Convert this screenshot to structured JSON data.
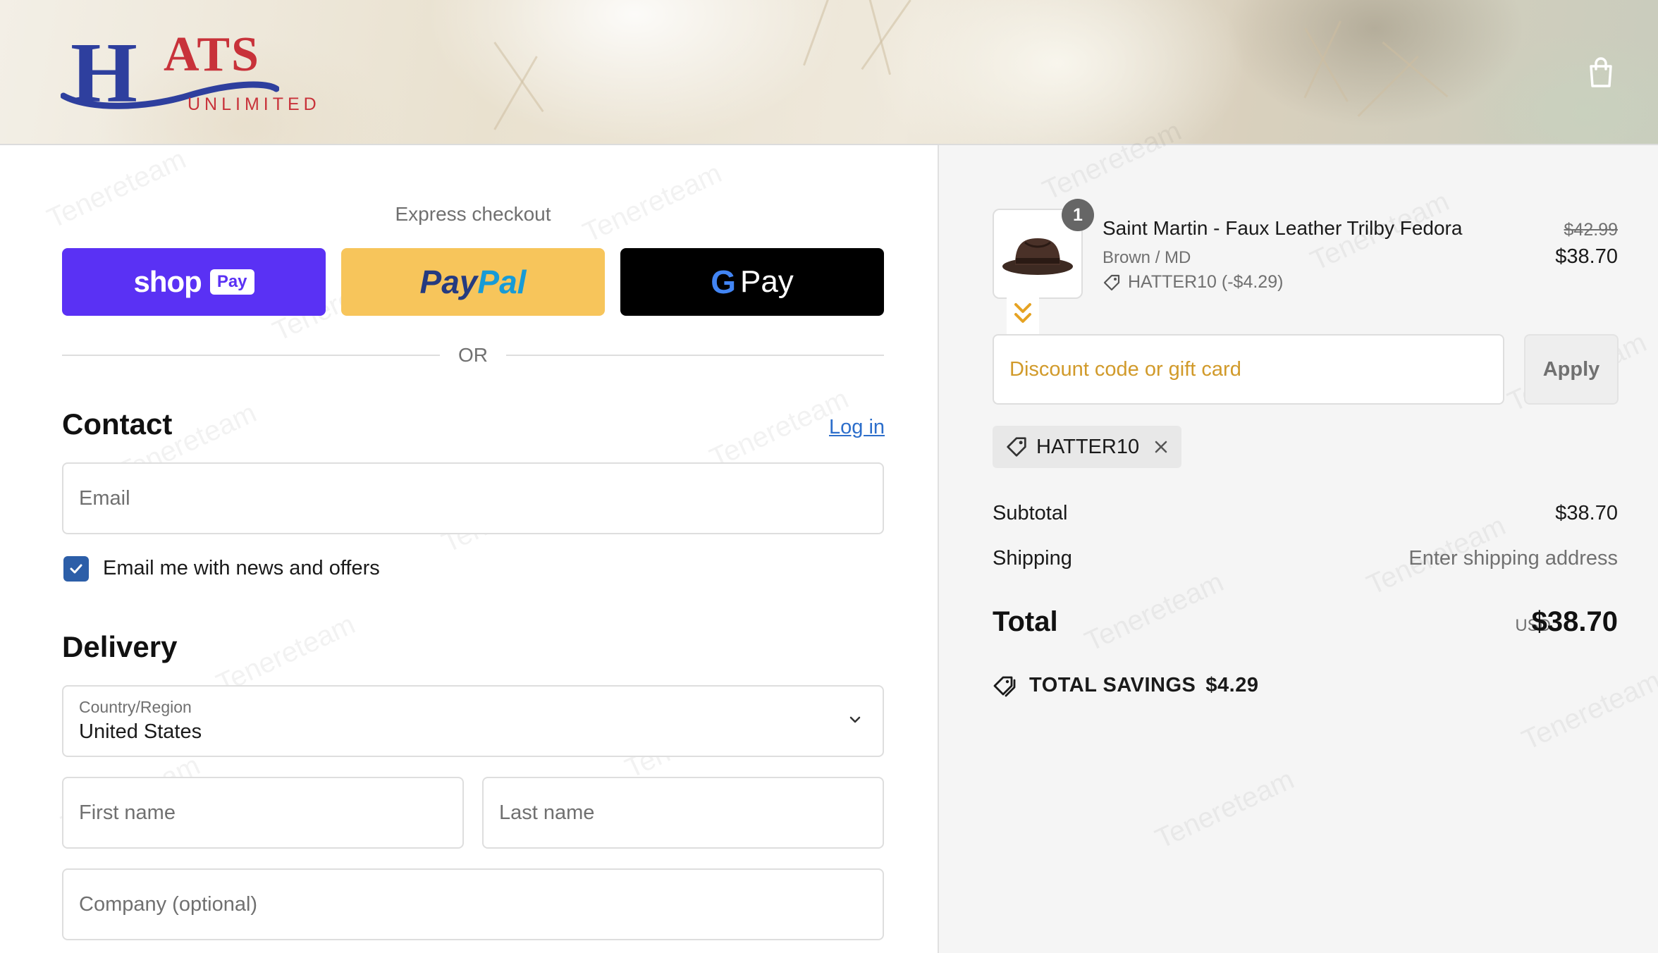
{
  "header": {
    "logo_main": "H",
    "logo_ats": "ATS",
    "logo_sub": "UNLIMITED",
    "cart_icon": "shopping-bag-icon"
  },
  "express": {
    "title": "Express checkout",
    "shop_pay": {
      "word": "shop",
      "badge": "Pay"
    },
    "paypal": {
      "part1": "Pay",
      "part2": "Pal"
    },
    "gpay": {
      "g": "G",
      "word": "Pay"
    },
    "or": "OR"
  },
  "contact": {
    "heading": "Contact",
    "login_label": "Log in",
    "email_placeholder": "Email",
    "newsletter_label": "Email me with news and offers",
    "newsletter_checked": true
  },
  "delivery": {
    "heading": "Delivery",
    "country_label": "Country/Region",
    "country_value": "United States",
    "first_name_placeholder": "First name",
    "last_name_placeholder": "Last name",
    "company_placeholder": "Company (optional)"
  },
  "order": {
    "quantity": "1",
    "product_name": "Saint Martin - Faux Leather Trilby Fedora",
    "variant": "Brown / MD",
    "line_discount": "HATTER10 (-$4.29)",
    "price_original": "$42.99",
    "price_current": "$38.70",
    "discount_placeholder": "Discount code or gift card",
    "apply_label": "Apply",
    "applied_code": "HATTER10",
    "subtotal_label": "Subtotal",
    "subtotal_value": "$38.70",
    "shipping_label": "Shipping",
    "shipping_value": "Enter shipping address",
    "total_label": "Total",
    "total_currency": "USD",
    "total_value": "$38.70",
    "savings_label": "TOTAL SAVINGS",
    "savings_value": "$4.29"
  },
  "colors": {
    "shop_pay": "#5a31f4",
    "paypal": "#f7c55b",
    "gpay": "#000000",
    "link": "#2c6ecb",
    "checkbox": "#2c5ea8",
    "discount_placeholder": "#d19a2a"
  }
}
